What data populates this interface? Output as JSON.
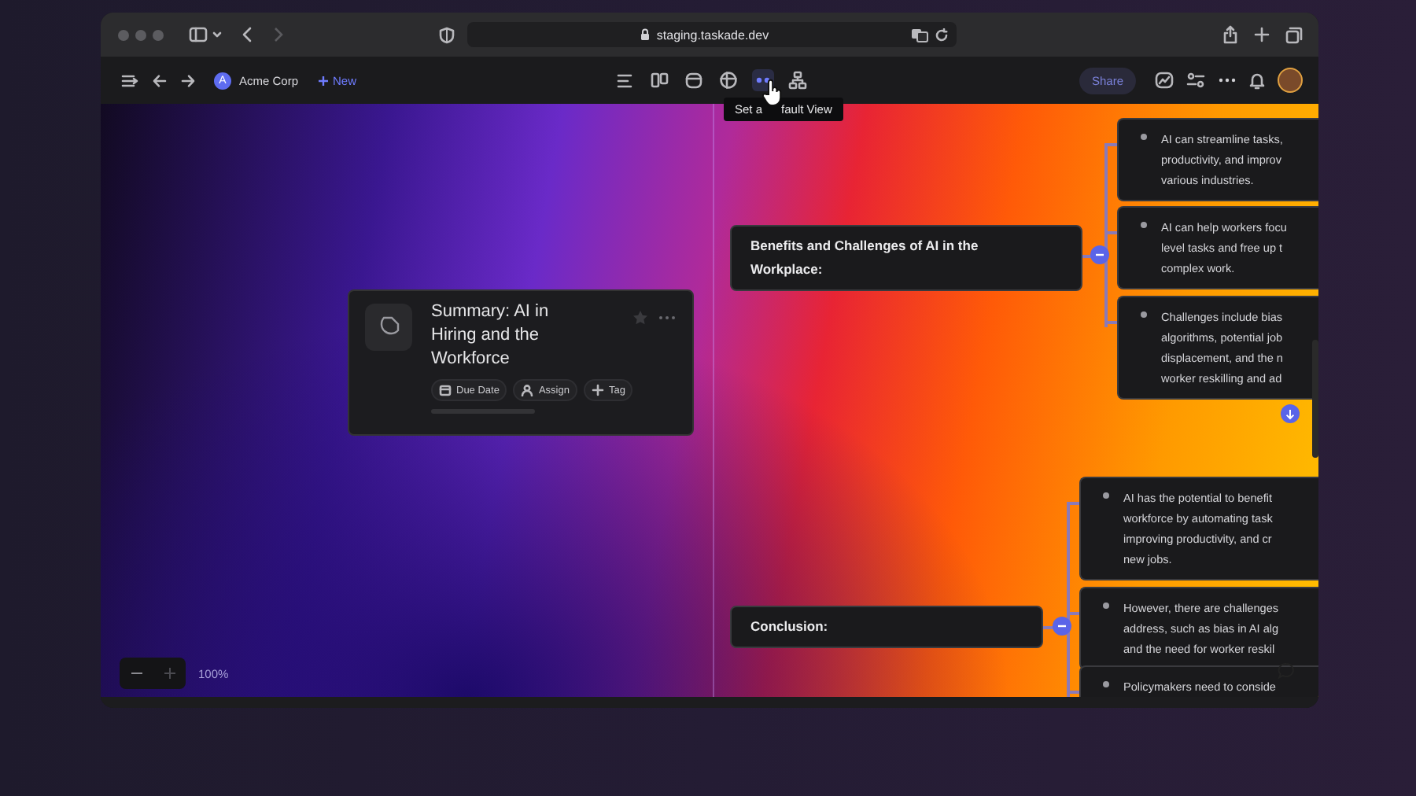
{
  "browser": {
    "url": "staging.taskade.dev"
  },
  "toolbar": {
    "workspace_initial": "A",
    "workspace": "Acme Corp",
    "new_label": "New",
    "views": [
      {
        "selected": false
      },
      {
        "selected": false
      },
      {
        "selected": false
      },
      {
        "selected": false
      },
      {
        "selected": true
      },
      {
        "selected": false
      }
    ],
    "share": "Share"
  },
  "tooltip": {
    "text_before": "Set a",
    "text_after": "fault View"
  },
  "canvas": {
    "summary": {
      "title": "Summary: AI in Hiring and the Workforce",
      "actions": [
        {
          "kind": "date",
          "label": "Due Date"
        },
        {
          "kind": "assign",
          "label": "Assign"
        },
        {
          "kind": "tag",
          "label": "Tag"
        }
      ]
    },
    "branches": [
      {
        "title": "Benefits and Challenges of AI in the Workplace:",
        "expanded": true,
        "children": [
          {
            "lines": [
              "AI can streamline tasks,",
              "productivity, and improv",
              "various industries."
            ]
          },
          {
            "lines": [
              "AI can help workers focu",
              "level tasks and free up t",
              "complex work."
            ]
          },
          {
            "lines": [
              "Challenges include bias",
              "algorithms, potential job",
              "displacement, and the n",
              "worker reskilling and ad"
            ]
          }
        ]
      },
      {
        "title": "Conclusion:",
        "expanded": true,
        "children": [
          {
            "lines": [
              "AI has the potential to benefit",
              "workforce by automating task",
              "improving productivity, and cr",
              "new jobs."
            ]
          },
          {
            "lines": [
              "However, there are challenges",
              "address, such as bias in AI alg",
              "and the need for worker reskil"
            ]
          },
          {
            "lines": [
              "Policymakers need to conside"
            ]
          }
        ]
      }
    ],
    "zoom": "100%"
  }
}
